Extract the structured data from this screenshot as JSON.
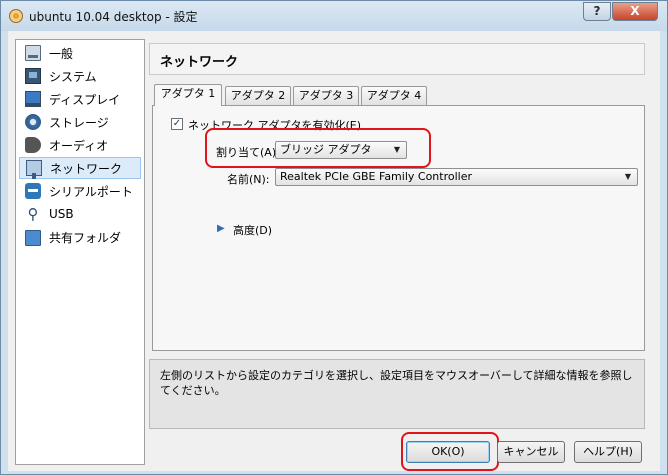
{
  "window": {
    "title": "ubuntu 10.04 desktop - 設定",
    "help_label": "?",
    "close_label": "X"
  },
  "sidebar": {
    "items": [
      {
        "label": "一般",
        "icon": "general-icon"
      },
      {
        "label": "システム",
        "icon": "system-icon"
      },
      {
        "label": "ディスプレイ",
        "icon": "display-icon"
      },
      {
        "label": "ストレージ",
        "icon": "storage-icon"
      },
      {
        "label": "オーディオ",
        "icon": "audio-icon"
      },
      {
        "label": "ネットワーク",
        "icon": "network-icon",
        "selected": true
      },
      {
        "label": "シリアルポート",
        "icon": "serial-port-icon"
      },
      {
        "label": "USB",
        "icon": "usb-icon"
      },
      {
        "label": "共有フォルダ",
        "icon": "shared-folder-icon"
      }
    ]
  },
  "page": {
    "title": "ネットワーク"
  },
  "tabs": [
    {
      "label": "アダプタ 1",
      "active": true
    },
    {
      "label": "アダプタ 2"
    },
    {
      "label": "アダプタ 3"
    },
    {
      "label": "アダプタ 4"
    }
  ],
  "adapter": {
    "enable_label": "ネットワーク アダプタを有効化(E)",
    "enable_checked": true,
    "check_mark": "✓",
    "attached_label": "割り当て(A):",
    "attached_value": "ブリッジ アダプタ",
    "name_label": "名前(N):",
    "name_value": "Realtek PCIe GBE Family Controller",
    "advanced_label": "高度(D)",
    "advanced_arrow": "▶",
    "dropdown_arrow": "▼"
  },
  "info": {
    "text": "左側のリストから設定のカテゴリを選択し、設定項目をマウスオーバーして詳細な情報を参照してください。"
  },
  "buttons": {
    "ok": "OK(O)",
    "cancel": "キャンセル",
    "help": "ヘルプ(H)"
  },
  "colors": {
    "highlight_outline": "#e0141b",
    "title_bar": "#cfe0ef"
  }
}
